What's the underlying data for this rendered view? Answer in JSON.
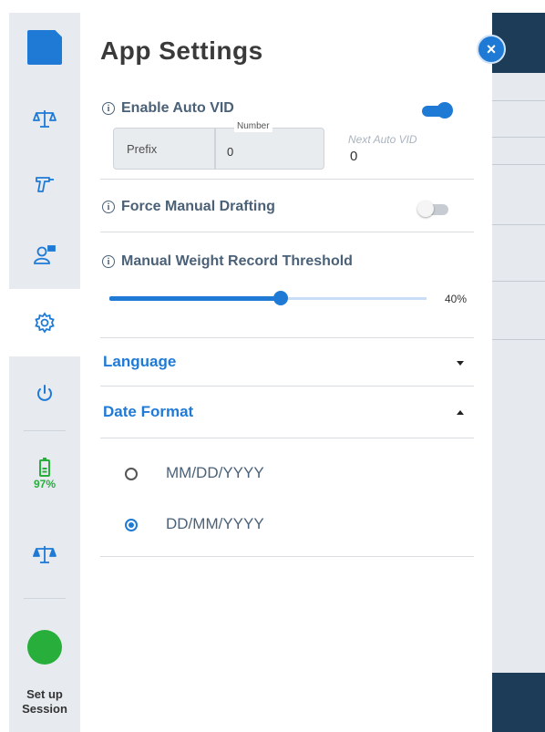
{
  "title": "App Settings",
  "close_symbol": "×",
  "rail": {
    "items": [
      {
        "icon": "app-logo-icon"
      },
      {
        "icon": "scale-icon"
      },
      {
        "icon": "drench-gun-icon"
      },
      {
        "icon": "user-tag-icon"
      },
      {
        "icon": "gear-icon",
        "active": true
      },
      {
        "icon": "power-icon"
      },
      {
        "icon": "battery-icon",
        "label": "97%"
      },
      {
        "icon": "scale-filled-icon"
      }
    ],
    "session_label_line1": "Set up",
    "session_label_line2": "Session"
  },
  "auto_vid": {
    "label": "Enable Auto VID",
    "toggle_on": true,
    "prefix_placeholder": "Prefix",
    "number_label": "Number",
    "number_value": "0",
    "next_label": "Next Auto VID",
    "next_value": "0"
  },
  "manual_drafting": {
    "label": "Force Manual Drafting",
    "toggle_on": false
  },
  "threshold": {
    "label": "Manual Weight Record Threshold",
    "value_percent": 40,
    "display": "40%"
  },
  "language": {
    "label": "Language",
    "expanded": false
  },
  "date_format": {
    "label": "Date Format",
    "expanded": true,
    "options": [
      "MM/DD/YYYY",
      "DD/MM/YYYY"
    ],
    "selected": "DD/MM/YYYY"
  },
  "colors": {
    "accent": "#1f7ad6",
    "success": "#27ae3b",
    "label_text": "#4b6178",
    "dark_header": "#1d3c57"
  }
}
